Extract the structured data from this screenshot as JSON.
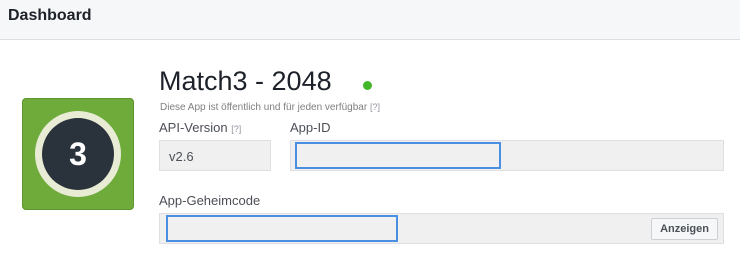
{
  "header": {
    "title": "Dashboard"
  },
  "app": {
    "icon_text": "3",
    "name": "Match3 - 2048",
    "status": "live",
    "status_color": "#42b72a",
    "visibility_note": "Diese App ist öffentlich und für jeden verfügbar",
    "visibility_help": "[?]"
  },
  "fields": {
    "api_version": {
      "label": "API-Version",
      "help": "[?]",
      "value": "v2.6"
    },
    "app_id": {
      "label": "App-ID",
      "value": ""
    },
    "app_secret": {
      "label": "App-Geheimcode",
      "value": "",
      "show_label": "Anzeigen"
    }
  },
  "colors": {
    "icon_bg": "#6eab3a",
    "focus": "#4a90e2"
  }
}
